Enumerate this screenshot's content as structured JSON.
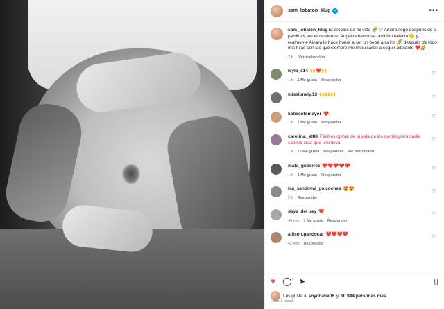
{
  "post": {
    "username": "sam_lobaton_klug",
    "verified": "✓",
    "more": "•••"
  },
  "caption": {
    "user": "sam_lobaton_klug",
    "text": "El arcoíris de mi vida 🌈🤍 Ainara llegó después de 2 perdidas, en el camino mi Angelita hermosa también falleció 😔 y realmente Ainara le hace honor a ser un bebé arcoíris 🌈 después de todo mis hijas son las que siempre me impulsaron a seguir adelante ❤️🌈",
    "age": "2 h",
    "translate": "Ver traducción"
  },
  "comments": [
    {
      "user": "leyla_s14",
      "text": "🙌❤️🙌",
      "age": "1 h",
      "likes": "1 Me gusta",
      "reply": "Responder",
      "translate": "",
      "avatar_color": "#7f8a6b"
    },
    {
      "user": "misslonely.13",
      "text": "🙌🙌🙌",
      "age": "",
      "likes": "",
      "reply": "",
      "translate": "",
      "avatar_color": "#6f6f6f"
    },
    {
      "user": "katiesotomayor",
      "text": "❤️",
      "age": "1 h",
      "likes": "1 Me gusta",
      "reply": "Responder",
      "translate": "",
      "avatar_color": "#c9a078"
    },
    {
      "user": "carolina._al88",
      "text": "Fácil es opinar de la vida de los demás,pero nadie sabe,la cruz que uno lleva",
      "age": "1 h",
      "likes": "15 Me gusta",
      "reply": "Responder",
      "translate": "Ver traducción",
      "avatar_color": "#9a7a98"
    },
    {
      "user": "mafa_gutierrez",
      "text": "❤️❤️❤️❤️❤️",
      "age": "1 h",
      "likes": "1 Me gusta",
      "reply": "Responder",
      "translate": "",
      "avatar_color": "#5a5a5a"
    },
    {
      "user": "isa_sandoval_goicochea",
      "text": "😍😍",
      "age": "2 h",
      "likes": "",
      "reply": "Responder",
      "translate": "",
      "avatar_color": "#8a8a8a"
    },
    {
      "user": "daya_del_rey",
      "text": "❤️",
      "age": "44 min",
      "likes": "1 Me gusta",
      "reply": "Responder",
      "translate": "",
      "avatar_color": "#a7a7a7"
    },
    {
      "user": "allison.pandocar",
      "text": "❤️❤️❤️❤️",
      "age": "42 min",
      "likes": "",
      "reply": "Responder",
      "translate": "",
      "avatar_color": "#b0876c"
    }
  ],
  "actions": {
    "like_icon": "heart-icon",
    "comment_icon": "comment-icon",
    "share_icon": "share-icon",
    "save_icon": "bookmark-icon"
  },
  "likes": {
    "prefix": "Les gusta a",
    "user": "soychabe06",
    "joiner": "y",
    "count": "10.944 personas más"
  },
  "timestamp": "Hace 2 horas",
  "colors": {
    "accent": "#0095f6",
    "like": "#ed4956",
    "muted": "#737373"
  }
}
